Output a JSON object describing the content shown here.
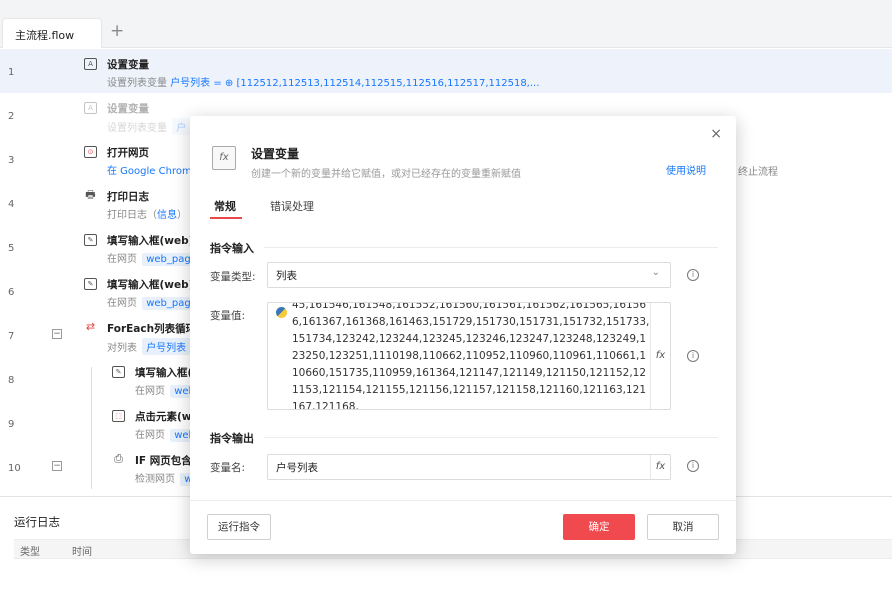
{
  "tabs": {
    "main_tab": "主流程.flow",
    "add": "+"
  },
  "rows": [
    {
      "num": "1",
      "icon": "A",
      "title": "设置变量",
      "sub_prefix": "设置列表变量",
      "tag": "户号列表",
      "sub_rest": "= ⊕ [112512,112513,112514,112515,112516,112517,112518,..."
    },
    {
      "num": "2",
      "icon": "A",
      "title": "设置变量",
      "sub_prefix": "设置列表变量",
      "tag": "户"
    },
    {
      "num": "3",
      "icon": "⊙",
      "title": "打开网页",
      "sub_prefix": "在 Google Chrom"
    },
    {
      "num": "4",
      "icon": "🖶",
      "title": "打印日志",
      "sub_prefix": "打印日志（",
      "tag": "信息",
      "sub_rest": "）"
    },
    {
      "num": "5",
      "icon": "✎",
      "title": "填写输入框(web)",
      "sub_prefix": "在网页",
      "tag": "web_pag"
    },
    {
      "num": "6",
      "icon": "✎",
      "title": "填写输入框(web)",
      "sub_prefix": "在网页",
      "tag": "web_pag"
    },
    {
      "num": "7",
      "icon": "⇄",
      "title": "ForEach列表循环",
      "sub_prefix": "对列表",
      "tag": "户号列表",
      "collapse": "−"
    },
    {
      "num": "8",
      "icon": "✎",
      "title": "填写输入框(",
      "sub_prefix": "在网页",
      "tag": "wel"
    },
    {
      "num": "9",
      "icon": "⬚",
      "title": "点击元素(we",
      "sub_prefix": "在网页",
      "tag": "wel"
    },
    {
      "num": "10",
      "icon": "⎙",
      "title": "IF 网页包含",
      "sub_prefix": "检测网页",
      "tag": "w",
      "collapse": "−"
    }
  ],
  "right_note": "终止流程",
  "log": {
    "title": "运行日志",
    "col_type": "类型",
    "col_time": "时间"
  },
  "dialog": {
    "close": "×",
    "icon": "fx",
    "title": "设置变量",
    "desc": "创建一个新的变量并给它赋值，或对已经存在的变量重新赋值",
    "help": "使用说明",
    "tab_general": "常规",
    "tab_error": "错误处理",
    "section_input": "指令输入",
    "label_type": "变量类型:",
    "type_value": "列表",
    "label_value": "变量值:",
    "value_text": "45,161546,161548,161552,161560,161561,161562,161565,161566,161367,161368,161463,151729,151730,151731,151732,151733,151734,123242,123244,123245,123246,123247,123248,123249,123250,123251,1110198,110662,110952,110960,110961,110661,110660,151735,110959,161364,121147,121149,121150,121152,121153,121154,121155,121156,121157,121158,121160,121163,121167,121168,",
    "fx": "fx",
    "info": "i",
    "section_output": "指令输出",
    "label_name": "变量名:",
    "name_value": "户号列表",
    "btn_run": "运行指令",
    "btn_ok": "确定",
    "btn_cancel": "取消"
  }
}
